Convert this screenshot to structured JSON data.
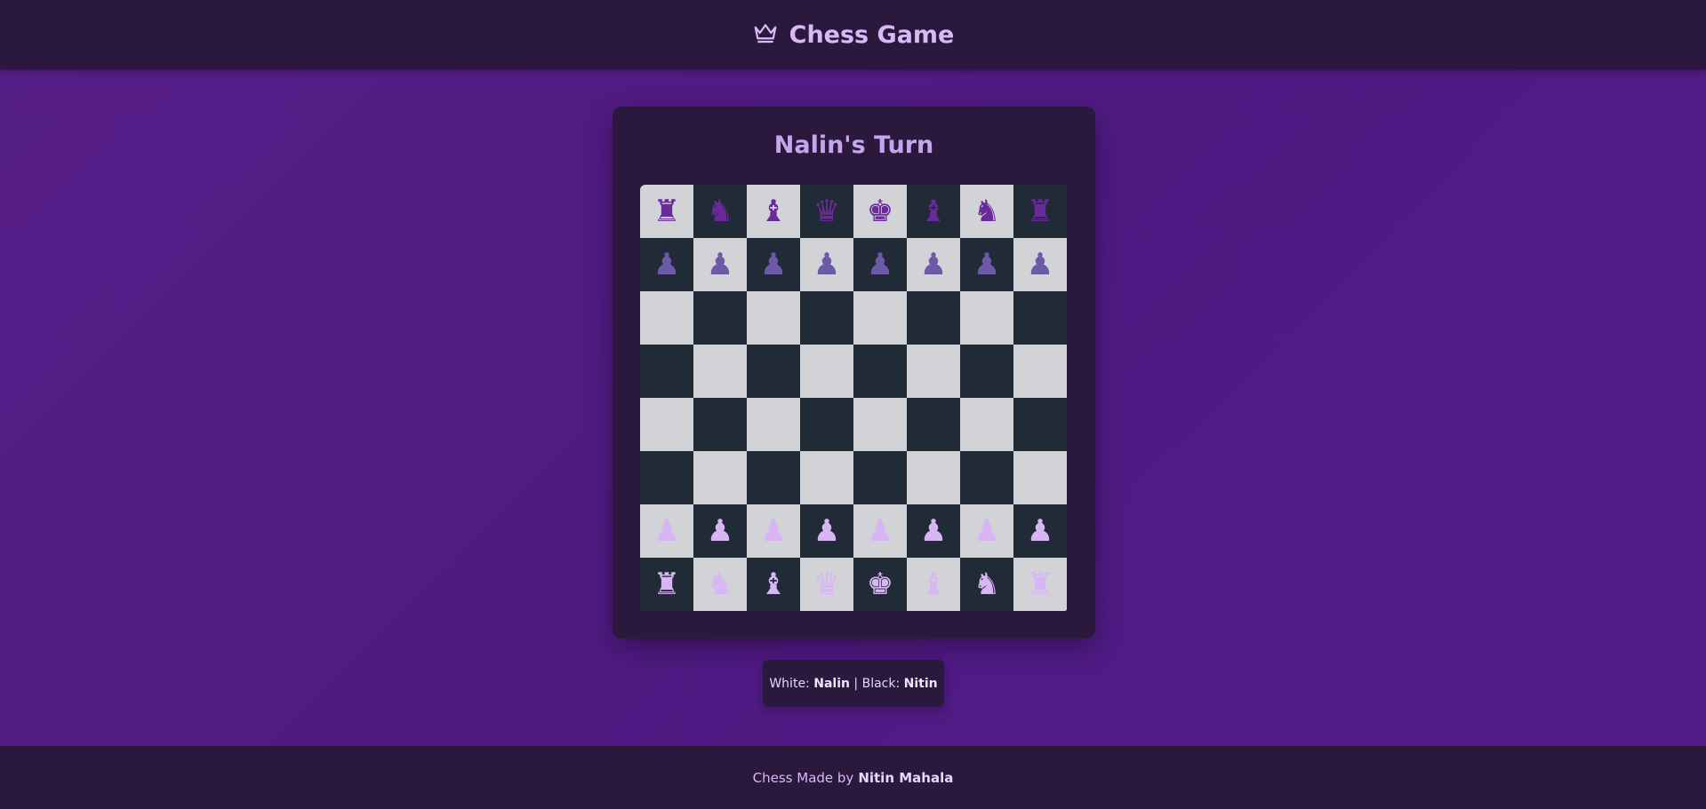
{
  "header": {
    "title": "Chess Game",
    "icon": "crown-icon"
  },
  "status": {
    "turn": "Nalin's Turn"
  },
  "board": {
    "rows": [
      [
        "br",
        "bn",
        "bb",
        "bq",
        "bk",
        "bb",
        "bn",
        "br"
      ],
      [
        "bp",
        "bp",
        "bp",
        "bp",
        "bp",
        "bp",
        "bp",
        "bp"
      ],
      [
        "",
        "",
        "",
        "",
        "",
        "",
        "",
        ""
      ],
      [
        "",
        "",
        "",
        "",
        "",
        "",
        "",
        ""
      ],
      [
        "",
        "",
        "",
        "",
        "",
        "",
        "",
        ""
      ],
      [
        "",
        "",
        "",
        "",
        "",
        "",
        "",
        ""
      ],
      [
        "wp",
        "wp",
        "wp",
        "wp",
        "wp",
        "wp",
        "wp",
        "wp"
      ],
      [
        "wr",
        "wn",
        "wb",
        "wq",
        "wk",
        "wb",
        "wn",
        "wr"
      ]
    ],
    "light_color": "#d2d3d7",
    "dark_color": "#212a37"
  },
  "players": {
    "white_label": "White:",
    "white_name": "Nalin",
    "separator": "|",
    "black_label": "Black:",
    "black_name": "Nitin"
  },
  "footer": {
    "text": "Chess Made by",
    "author": "Nitin Mahala"
  },
  "colors": {
    "accent": "#d9b8f7",
    "panel": "#2a193c",
    "background": "#561d87"
  }
}
